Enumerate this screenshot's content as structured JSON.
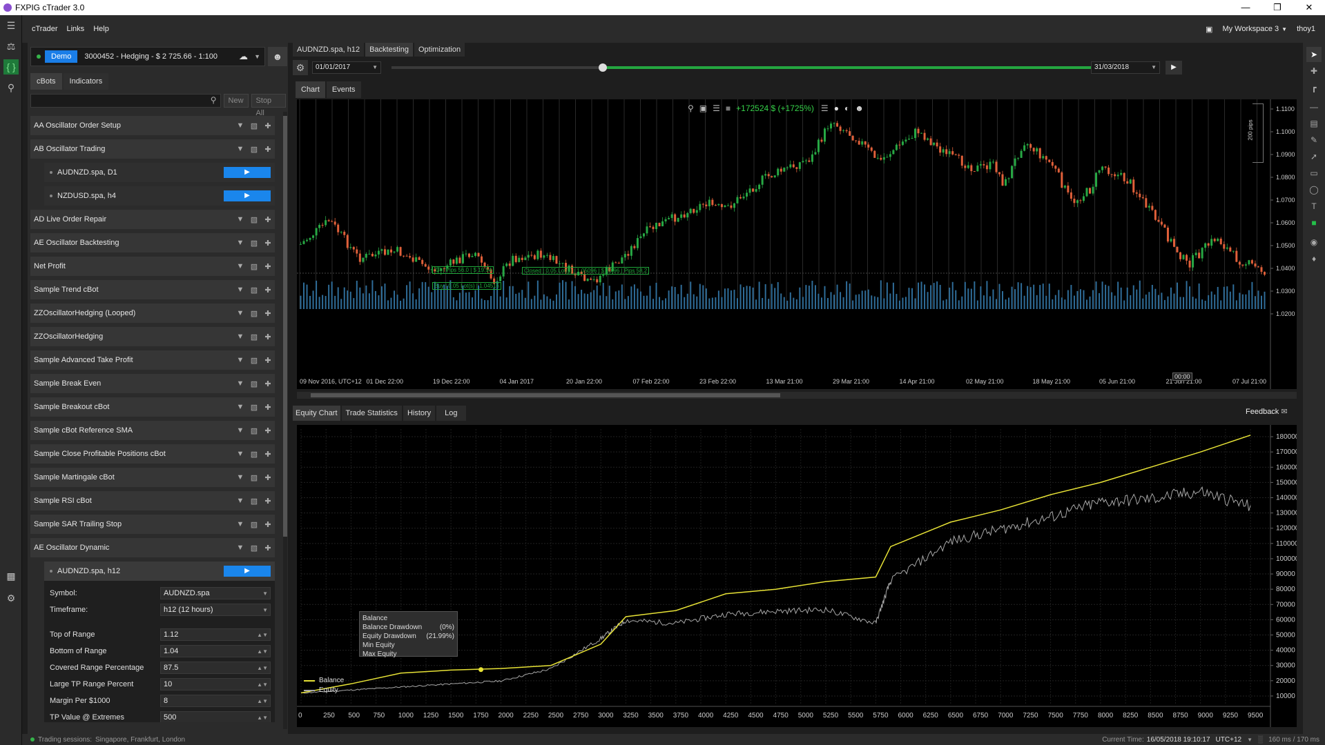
{
  "window": {
    "title": "FXPIG cTrader 3.0"
  },
  "menu": {
    "items": [
      "cTrader",
      "Links",
      "Help"
    ],
    "workspace": "My Workspace 3",
    "user": "thoy1"
  },
  "account": {
    "badge": "Demo",
    "text": "3000452 - Hedging - $ 2 725.66 - 1:100"
  },
  "panel_tabs": [
    "cBots",
    "Indicators"
  ],
  "search": {
    "new_label": "New",
    "stop_all_label": "Stop All"
  },
  "bots": [
    "AA Oscillator Order Setup",
    "AB Oscillator Trading",
    "AD Live Order Repair",
    "AE Oscillator Backtesting",
    "Net Profit",
    "Sample Trend cBot",
    "ZZOscillatorHedging (Looped)",
    "ZZOscillatorHedging",
    "Sample Advanced Take Profit",
    "Sample Break Even",
    "Sample Breakout cBot",
    "Sample cBot Reference SMA",
    "Sample Close Profitable Positions cBot",
    "Sample Martingale cBot",
    "Sample RSI cBot",
    "Sample SAR Trailing Stop",
    "AE Oscillator Dynamic"
  ],
  "instances": {
    "ab": [
      "AUDNZD.spa, D1",
      "NZDUSD.spa, h4"
    ],
    "ae": "AUDNZD.spa, h12"
  },
  "params": [
    {
      "k": "Symbol:",
      "v": "AUDNZD.spa"
    },
    {
      "k": "Timeframe:",
      "v": "h12 (12 hours)"
    },
    {
      "k": "Top of Range",
      "v": "1.12"
    },
    {
      "k": "Bottom of Range",
      "v": "1.04"
    },
    {
      "k": "Covered Range Percentage",
      "v": "87.5"
    },
    {
      "k": "Large TP Range Percent",
      "v": "10"
    },
    {
      "k": "Margin Per $1000",
      "v": "8"
    },
    {
      "k": "TP Value @ Extremes",
      "v": "500"
    }
  ],
  "top_tabs": [
    "AUDNZD.spa, h12",
    "Backtesting",
    "Optimization"
  ],
  "backtest": {
    "start": "01/01/2017",
    "end": "31/03/2018"
  },
  "chart_tabs": [
    "Chart",
    "Events"
  ],
  "lower_tabs": [
    "Equity Chart",
    "Trade Statistics",
    "History",
    "Log"
  ],
  "feedback": "Feedback",
  "price_chart": {
    "profit": "+172524 $ (+1725%)",
    "pips": "200 pips",
    "y_ticks": [
      "1.1100",
      "1.1000",
      "1.0900",
      "1.0800",
      "1.0700",
      "1.0600",
      "1.0500",
      "1.0400",
      "1.0300",
      "1.0200"
    ],
    "x_ticks": [
      "09 Nov 2016, UTC+12",
      "01 Dec 22:00",
      "19 Dec 22:00",
      "04 Jan 2017",
      "20 Jan 22:00",
      "07 Feb 22:00",
      "23 Feb 22:00",
      "13 Mar 21:00",
      "29 Mar 21:00",
      "14 Apr 21:00",
      "02 May 21:00",
      "18 May 21:00",
      "05 Jun 21:00",
      "21 Jun 21:00",
      "07 Jul 21:00"
    ],
    "cursor_time": "00:00",
    "tp_label": "TP | Pips 56.0 | $ 19.94",
    "buy_label": "Buy | 0.05 Lot(s) | 1.04516",
    "closed_label": "Closed | 0.05 Lot(s) | 1.05096 | $ 20.96 | Pips 58.2"
  },
  "chart_data": {
    "type": "line",
    "x": [
      0,
      500,
      1000,
      1500,
      2000,
      2500,
      3000,
      3250,
      3750,
      4250,
      4750,
      5250,
      5750,
      5900,
      6500,
      7000,
      7500,
      8000,
      8500,
      9000,
      9500
    ],
    "series": [
      {
        "name": "Balance",
        "values": [
          12000,
          18000,
          25000,
          27000,
          28000,
          30000,
          44000,
          62000,
          66000,
          77000,
          80000,
          85000,
          88000,
          108000,
          124000,
          132000,
          142000,
          150000,
          160000,
          170000,
          181000
        ]
      },
      {
        "name": "Equity",
        "values": [
          12000,
          14000,
          16000,
          18000,
          20000,
          28000,
          48000,
          60000,
          58000,
          64000,
          66000,
          67000,
          58000,
          86000,
          112000,
          120000,
          128000,
          138000,
          140000,
          145000,
          135000
        ]
      }
    ],
    "x_ticks": [
      "0",
      "250",
      "500",
      "750",
      "1000",
      "1250",
      "1500",
      "1750",
      "2000",
      "2250",
      "2500",
      "2750",
      "3000",
      "3250",
      "3500",
      "3750",
      "4000",
      "4250",
      "4500",
      "4750",
      "5000",
      "5250",
      "5500",
      "5750",
      "6000",
      "6250",
      "6500",
      "6750",
      "7000",
      "7250",
      "7500",
      "7750",
      "8000",
      "8250",
      "8500",
      "8750",
      "9000",
      "9250",
      "9500"
    ],
    "y_ticks": [
      "180000",
      "170000",
      "160000",
      "150000",
      "140000",
      "130000",
      "120000",
      "110000",
      "100000",
      "90000",
      "80000",
      "70000",
      "60000",
      "50000",
      "40000",
      "30000",
      "20000",
      "10000"
    ],
    "ylim": [
      5000,
      185000
    ],
    "xlim": [
      0,
      9700
    ],
    "colors": {
      "Balance": "#e8e336",
      "Equity": "#a8a8a8"
    },
    "grid": true,
    "legend": "bottom-left"
  },
  "tooltip": {
    "title": "Balance",
    "rows": [
      {
        "k": "Balance Drawdown",
        "v": "(0%)"
      },
      {
        "k": "Equity Drawdown",
        "v": "(21.99%)"
      },
      {
        "k": "Min Equity",
        "v": ""
      },
      {
        "k": "Max Equity",
        "v": ""
      }
    ]
  },
  "status": {
    "sessions_label": "Trading sessions:",
    "sessions": "Singapore, Frankfurt, London",
    "current_time_label": "Current Time:",
    "current_time": "16/05/2018 19:10:17",
    "tz": "UTC+12",
    "latency": "160 ms / 170 ms"
  }
}
